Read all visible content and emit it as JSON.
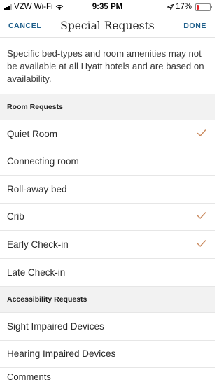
{
  "status_bar": {
    "carrier": "VZW Wi-Fi",
    "time": "9:35 PM",
    "battery": "17%",
    "battery_level": 0.17
  },
  "nav": {
    "cancel": "CANCEL",
    "title": "Special Requests",
    "done": "DONE"
  },
  "intro": "Specific bed-types and room amenities may not be available at all Hyatt hotels and are based on availability.",
  "room_requests": {
    "header": "Room Requests",
    "items": [
      {
        "label": "Quiet Room",
        "checked": true
      },
      {
        "label": "Connecting room",
        "checked": false
      },
      {
        "label": "Roll-away bed",
        "checked": false
      },
      {
        "label": "Crib",
        "checked": true
      },
      {
        "label": "Early Check-in",
        "checked": true
      },
      {
        "label": "Late Check-in",
        "checked": false
      }
    ]
  },
  "accessibility_requests": {
    "header": "Accessibility Requests",
    "items": [
      {
        "label": "Sight Impaired Devices",
        "checked": false
      },
      {
        "label": "Hearing Impaired Devices",
        "checked": false
      }
    ]
  },
  "comments_label": "Comments",
  "colors": {
    "accent": "#1f5f8b",
    "check": "#c9875a",
    "battery": "#e3242b"
  }
}
